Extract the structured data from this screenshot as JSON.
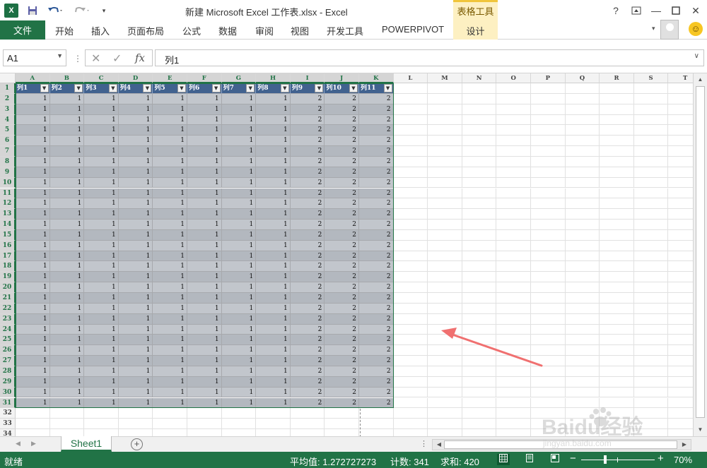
{
  "app": {
    "logo_text": "X",
    "title": "新建 Microsoft Excel 工作表.xlsx - Excel",
    "context_group": "表格工具",
    "context_tab": "设计"
  },
  "ribbon": {
    "file_tab": "文件",
    "tabs": [
      "开始",
      "插入",
      "页面布局",
      "公式",
      "数据",
      "审阅",
      "视图",
      "开发工具",
      "POWERPIVOT"
    ]
  },
  "formula_bar": {
    "name_box": "A1",
    "fx": "fx",
    "content": "列1"
  },
  "grid": {
    "columns": [
      "A",
      "B",
      "C",
      "D",
      "E",
      "F",
      "G",
      "H",
      "I",
      "J",
      "K",
      "L",
      "M",
      "N",
      "O",
      "P",
      "Q",
      "R",
      "S",
      "T"
    ],
    "rows_shown": [
      "1",
      "2",
      "3",
      "4",
      "5",
      "6",
      "7",
      "8",
      "9",
      "10",
      "11",
      "12",
      "13",
      "14",
      "15",
      "16",
      "17",
      "18",
      "19",
      "20",
      "21",
      "22",
      "23",
      "24",
      "25",
      "26",
      "27",
      "28",
      "29",
      "30",
      "31",
      "32",
      "33",
      "34"
    ],
    "table_headers": [
      "列1",
      "列2",
      "列3",
      "列4",
      "列5",
      "列6",
      "列7",
      "列8",
      "列9",
      "列10",
      "列11"
    ],
    "table_row_values": [
      "1",
      "1",
      "1",
      "1",
      "1",
      "1",
      "1",
      "1",
      "2",
      "2",
      "2"
    ],
    "table_data_row_count": 30
  },
  "sheets": {
    "active": "Sheet1"
  },
  "status": {
    "ready": "就绪",
    "average": "平均值: 1.272727273",
    "count": "计数: 341",
    "sum": "求和: 420",
    "zoom": "70%"
  },
  "colors": {
    "excel_green": "#217346",
    "table_header": "#41628f",
    "annotation_arrow": "#f07070"
  },
  "watermark": {
    "brand": "Baidu经验",
    "url": "jingyan.baidu.com"
  }
}
